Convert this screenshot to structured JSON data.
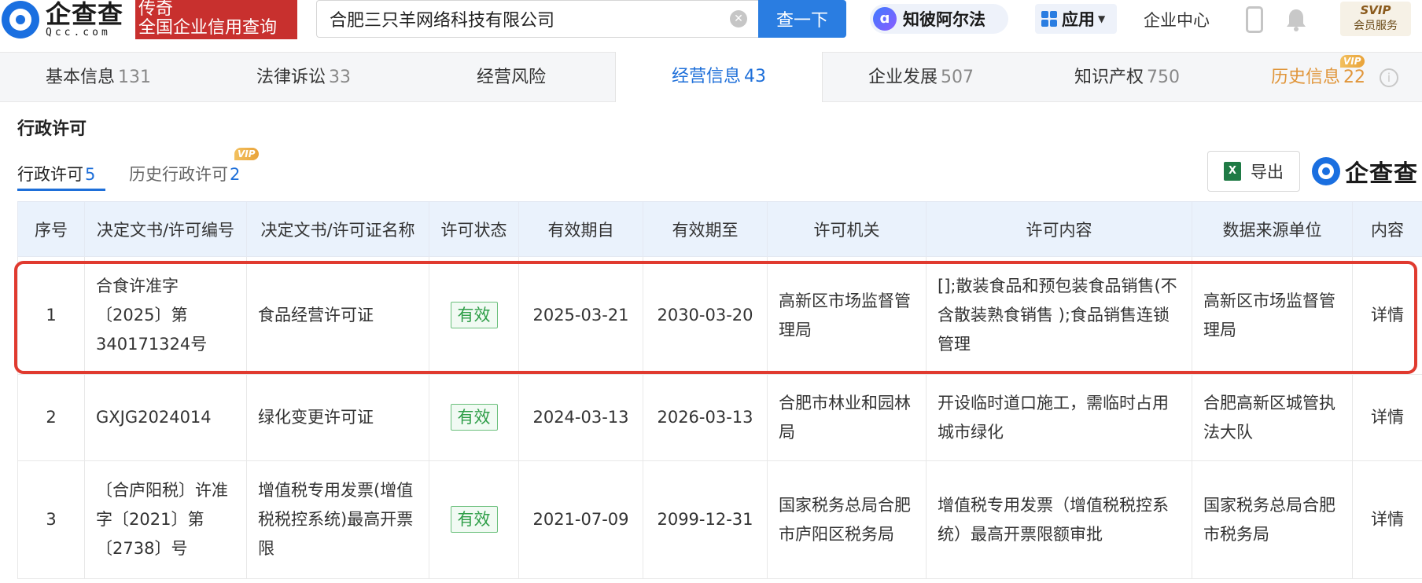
{
  "header": {
    "logo_cn": "企查查",
    "logo_en": "Qcc.com",
    "legend_line1": "传奇",
    "legend_line2": "全国企业信用查询",
    "search_value": "合肥三只羊网络科技有限公司",
    "search_button": "查一下",
    "zhibi_label": "知彼阿尔法",
    "app_label": "应用",
    "enterprise_center": "企业中心",
    "svip_title": "SVIP",
    "svip_sub": "会员服务",
    "brand_color": "#2a7de1"
  },
  "main_tabs": [
    {
      "label": "基本信息",
      "count": "131"
    },
    {
      "label": "法律诉讼",
      "count": "33"
    },
    {
      "label": "经营风险",
      "count": ""
    },
    {
      "label": "经营信息",
      "count": "43"
    },
    {
      "label": "企业发展",
      "count": "507"
    },
    {
      "label": "知识产权",
      "count": "750"
    },
    {
      "label": "历史信息",
      "count": "22",
      "badge": "VIP"
    }
  ],
  "section": {
    "title": "行政许可",
    "sub_tabs": [
      {
        "label": "行政许可",
        "count": "5"
      },
      {
        "label": "历史行政许可",
        "count": "2",
        "badge": "VIP"
      }
    ],
    "export_label": "导出",
    "watermark": "企查查"
  },
  "table": {
    "headers": [
      "序号",
      "决定文书/许可编号",
      "决定文书/许可证名称",
      "许可状态",
      "有效期自",
      "有效期至",
      "许可机关",
      "许可内容",
      "数据来源单位",
      "内容"
    ],
    "rows": [
      {
        "no": "1",
        "doc_no": "合食许准字〔2025〕第340171324号",
        "doc_name": "食品经营许可证",
        "status": "有效",
        "from": "2025-03-21",
        "to": "2030-03-20",
        "authority": "高新区市场监督管理局",
        "content": "[];散装食品和预包装食品销售(不含散装熟食销售 );食品销售连锁管理",
        "source": "高新区市场监督管理局",
        "detail": "详情"
      },
      {
        "no": "2",
        "doc_no": "GXJG2024014",
        "doc_name": "绿化变更许可证",
        "status": "有效",
        "from": "2024-03-13",
        "to": "2026-03-13",
        "authority": "合肥市林业和园林局",
        "content": "开设临时道口施工，需临时占用城市绿化",
        "source": "合肥高新区城管执法大队",
        "detail": "详情"
      },
      {
        "no": "3",
        "doc_no": "〔合庐阳税〕许准字〔2021〕第〔2738〕号",
        "doc_name": "增值税专用发票(增值税税控系统)最高开票限",
        "status": "有效",
        "from": "2021-07-09",
        "to": "2099-12-31",
        "authority": "国家税务总局合肥市庐阳区税务局",
        "content": "增值税专用发票（增值税税控系统）最高开票限额审批",
        "source": "国家税务总局合肥市税务局",
        "detail": "详情"
      }
    ]
  },
  "colors": {
    "accent": "#1e6fd9",
    "status_valid": "#2f9e48",
    "highlight": "#e03a2f",
    "vip": "#e9a33a"
  }
}
